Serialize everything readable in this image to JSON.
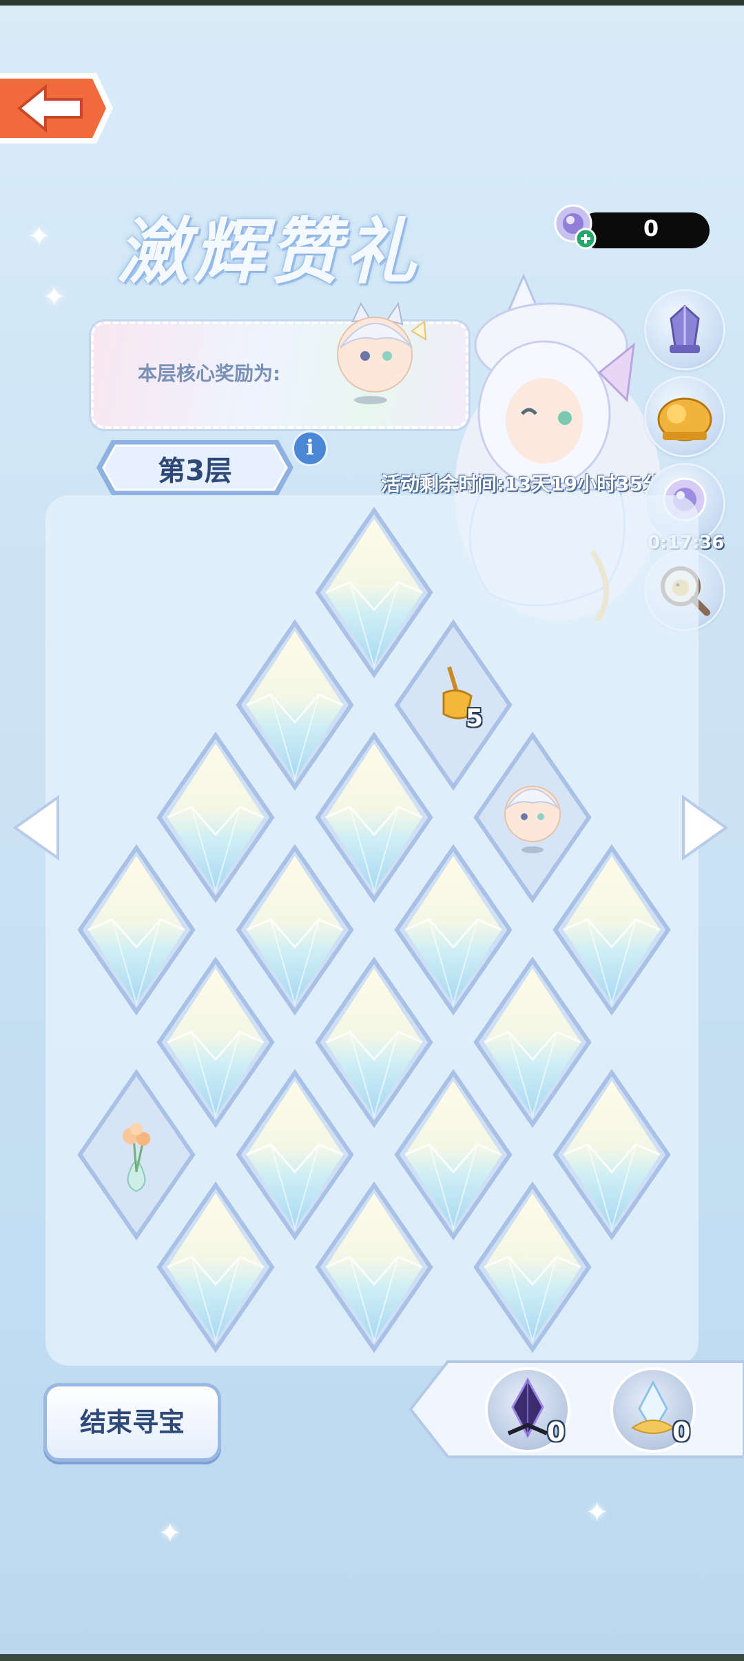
{
  "header": {
    "title": "瀲辉赞礼",
    "currency_value": "0"
  },
  "reward_panel": {
    "label": "本层核心奖励为:"
  },
  "floor": {
    "label": "第3层",
    "info_icon": "i"
  },
  "event": {
    "remaining_time": "活动剩余时间:13天19小时35分"
  },
  "side_buttons": [
    {
      "name": "crystal-shop-icon"
    },
    {
      "name": "golden-lion-icon"
    },
    {
      "name": "crystal-orb-timer-icon",
      "timer": "0:17:36"
    },
    {
      "name": "magnifier-icon"
    }
  ],
  "board": {
    "tiles": [
      {
        "row": 0,
        "col": 3,
        "state": "crystal"
      },
      {
        "row": 1,
        "col": 2,
        "state": "crystal"
      },
      {
        "row": 1,
        "col": 4,
        "state": "broom",
        "count": "5"
      },
      {
        "row": 2,
        "col": 1,
        "state": "crystal"
      },
      {
        "row": 2,
        "col": 3,
        "state": "crystal"
      },
      {
        "row": 2,
        "col": 5,
        "state": "character"
      },
      {
        "row": 3,
        "col": 0,
        "state": "crystal"
      },
      {
        "row": 3,
        "col": 2,
        "state": "crystal"
      },
      {
        "row": 3,
        "col": 4,
        "state": "crystal"
      },
      {
        "row": 3,
        "col": 6,
        "state": "crystal"
      },
      {
        "row": 4,
        "col": 1,
        "state": "crystal"
      },
      {
        "row": 4,
        "col": 3,
        "state": "crystal"
      },
      {
        "row": 4,
        "col": 5,
        "state": "crystal"
      },
      {
        "row": 5,
        "col": 0,
        "state": "flower"
      },
      {
        "row": 5,
        "col": 2,
        "state": "crystal"
      },
      {
        "row": 5,
        "col": 4,
        "state": "crystal"
      },
      {
        "row": 5,
        "col": 6,
        "state": "crystal"
      },
      {
        "row": 6,
        "col": 1,
        "state": "crystal"
      },
      {
        "row": 6,
        "col": 3,
        "state": "crystal"
      },
      {
        "row": 6,
        "col": 5,
        "state": "crystal"
      }
    ]
  },
  "actions": {
    "end_label": "结束寻宝"
  },
  "inventory": [
    {
      "name": "dark-crystal-icon",
      "count": "0"
    },
    {
      "name": "light-crystal-icon",
      "count": "0"
    }
  ],
  "colors": {
    "accent_blue": "#4a88d6",
    "text_navy": "#2e4978",
    "back_orange": "#f06a3c"
  }
}
